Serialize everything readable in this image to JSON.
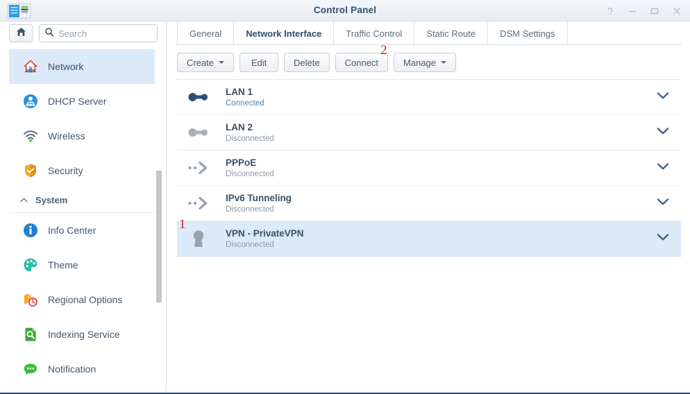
{
  "window": {
    "title": "Control Panel",
    "app_icon": "control-panel-icon",
    "controls": [
      {
        "name": "help-icon",
        "glyph": "?"
      },
      {
        "name": "minimize-icon",
        "glyph": "−"
      },
      {
        "name": "maximize-icon",
        "glyph": "▭"
      },
      {
        "name": "close-icon",
        "glyph": "✕"
      }
    ]
  },
  "sidebar": {
    "home_button": "home-icon",
    "search": {
      "placeholder": "Search",
      "value": "",
      "icon": "search-icon"
    },
    "items": [
      {
        "label": "Network",
        "icon": "network-house-icon",
        "active": true,
        "type": "item"
      },
      {
        "label": "DHCP Server",
        "icon": "dhcp-server-icon",
        "active": false,
        "type": "item"
      },
      {
        "label": "Wireless",
        "icon": "wireless-icon",
        "active": false,
        "type": "item"
      },
      {
        "label": "Security",
        "icon": "shield-icon",
        "active": false,
        "type": "item"
      },
      {
        "label": "System",
        "icon": "chevron-up-icon",
        "active": false,
        "type": "group"
      },
      {
        "label": "Info Center",
        "icon": "info-icon",
        "active": false,
        "type": "item"
      },
      {
        "label": "Theme",
        "icon": "palette-icon",
        "active": false,
        "type": "item"
      },
      {
        "label": "Regional Options",
        "icon": "regional-options-icon",
        "active": false,
        "type": "item"
      },
      {
        "label": "Indexing Service",
        "icon": "indexing-service-icon",
        "active": false,
        "type": "item"
      },
      {
        "label": "Notification",
        "icon": "notification-icon",
        "active": false,
        "type": "item"
      }
    ]
  },
  "main": {
    "tabs": [
      {
        "label": "General",
        "active": false
      },
      {
        "label": "Network Interface",
        "active": true
      },
      {
        "label": "Traffic Control",
        "active": false
      },
      {
        "label": "Static Route",
        "active": false
      },
      {
        "label": "DSM Settings",
        "active": false
      }
    ],
    "toolbar": [
      {
        "label": "Create",
        "dropdown": true
      },
      {
        "label": "Edit",
        "dropdown": false
      },
      {
        "label": "Delete",
        "dropdown": false
      },
      {
        "label": "Connect",
        "dropdown": false
      },
      {
        "label": "Manage",
        "dropdown": true
      }
    ],
    "interfaces": [
      {
        "name": "LAN 1",
        "status": "Connected",
        "icon": "lan-connected-icon",
        "selected": false
      },
      {
        "name": "LAN 2",
        "status": "Disconnected",
        "icon": "lan-disconnected-icon",
        "selected": false
      },
      {
        "name": "PPPoE",
        "status": "Disconnected",
        "icon": "pppoe-arrow-icon",
        "selected": false
      },
      {
        "name": "IPv6 Tunneling",
        "status": "Disconnected",
        "icon": "tunnel-arrow-icon",
        "selected": false
      },
      {
        "name": "VPN - PrivateVPN",
        "status": "Disconnected",
        "icon": "vpn-keyhole-icon",
        "selected": true
      }
    ],
    "expand_icon": "chevron-down-icon"
  },
  "annotations": [
    {
      "id": "1",
      "label": "1",
      "target": "vpn-privatevpn-row"
    },
    {
      "id": "2",
      "label": "2",
      "target": "connect-button"
    }
  ],
  "colors": {
    "accent": "#2c4d70",
    "selected_row": "#dce9f8",
    "annotation": "#e01b1b",
    "lan_connected": "#2d5077",
    "lan_disconnected": "#a8b0b8"
  }
}
